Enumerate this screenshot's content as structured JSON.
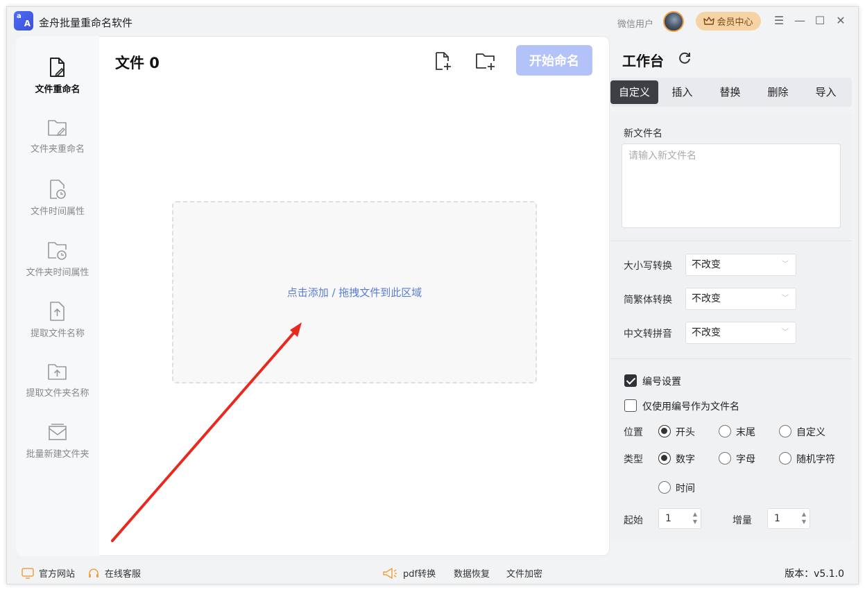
{
  "app": {
    "title": "金舟批量重命名软件",
    "user_name": "微信用户",
    "vip_label": "会员中心",
    "brand_color": "#4f6df5"
  },
  "nav": {
    "items": [
      {
        "label": "文件重命名",
        "icon": "file-edit-icon",
        "active": true
      },
      {
        "label": "文件夹重命名",
        "icon": "folder-edit-icon",
        "active": false
      },
      {
        "label": "文件时间属性",
        "icon": "file-clock-icon",
        "active": false
      },
      {
        "label": "文件夹时间属性",
        "icon": "folder-clock-icon",
        "active": false
      },
      {
        "label": "提取文件名称",
        "icon": "file-upload-icon",
        "active": false
      },
      {
        "label": "提取文件夹名称",
        "icon": "folder-upload-icon",
        "active": false
      },
      {
        "label": "批量新建文件夹",
        "icon": "batch-folder-icon",
        "active": false
      }
    ]
  },
  "main": {
    "file_count_label": "文件 0",
    "start_button": "开始命名",
    "drop_hint": "点击添加 / 拖拽文件到此区域"
  },
  "workspace": {
    "title": "工作台",
    "tabs": [
      "自定义",
      "插入",
      "替换",
      "删除",
      "导入"
    ],
    "active_tab": "自定义",
    "new_name_label": "新文件名",
    "new_name_placeholder": "请输入新文件名",
    "case_label": "大小写转换",
    "case_value": "不改变",
    "trad_label": "简繁体转换",
    "trad_value": "不改变",
    "pinyin_label": "中文转拼音",
    "pinyin_value": "不改变",
    "numbering_label": "编号设置",
    "numbering_checked": true,
    "only_number_label": "仅使用编号作为文件名",
    "only_number_checked": false,
    "position_label": "位置",
    "position_options": [
      "开头",
      "末尾",
      "自定义"
    ],
    "position_selected": "开头",
    "type_label": "类型",
    "type_options": [
      "数字",
      "字母",
      "随机字符",
      "时间"
    ],
    "type_selected": "数字",
    "start_label": "起始",
    "start_value": "1",
    "step_label": "增量",
    "step_value": "1"
  },
  "footer": {
    "website": "官方网站",
    "support": "在线客服",
    "pdf": "pdf转换",
    "recovery": "数据恢复",
    "encrypt": "文件加密",
    "version": "版本：v5.1.0"
  }
}
